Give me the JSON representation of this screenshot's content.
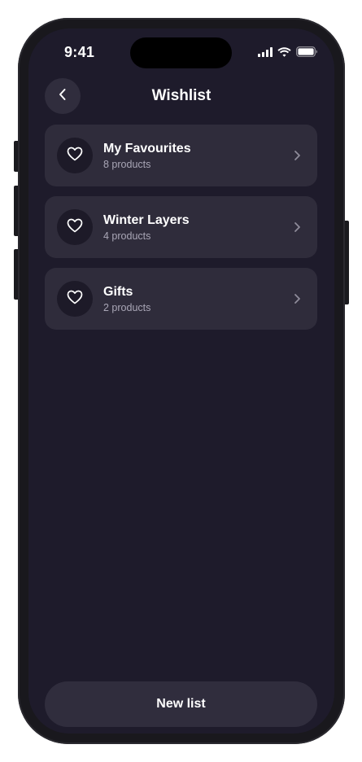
{
  "status_bar": {
    "time": "9:41",
    "icons": [
      "signal-icon",
      "wifi-icon",
      "battery-icon"
    ]
  },
  "header": {
    "back_icon": "chevron-left-icon",
    "title": "Wishlist"
  },
  "lists": [
    {
      "icon": "heart-icon",
      "title": "My Favourites",
      "subtitle": "8 products",
      "chevron": "chevron-right-icon"
    },
    {
      "icon": "heart-icon",
      "title": "Winter Layers",
      "subtitle": "4 products",
      "chevron": "chevron-right-icon"
    },
    {
      "icon": "heart-icon",
      "title": "Gifts",
      "subtitle": "2 products",
      "chevron": "chevron-right-icon"
    }
  ],
  "footer": {
    "new_list_label": "New list"
  },
  "colors": {
    "screen_bg": "#1e1b2b",
    "card_bg": "#2f2c3b",
    "icon_circle_bg": "#1d1a28",
    "button_bg": "#302d3d",
    "subtitle_text": "#a9a6b6",
    "chevron": "#8f8c9a"
  }
}
